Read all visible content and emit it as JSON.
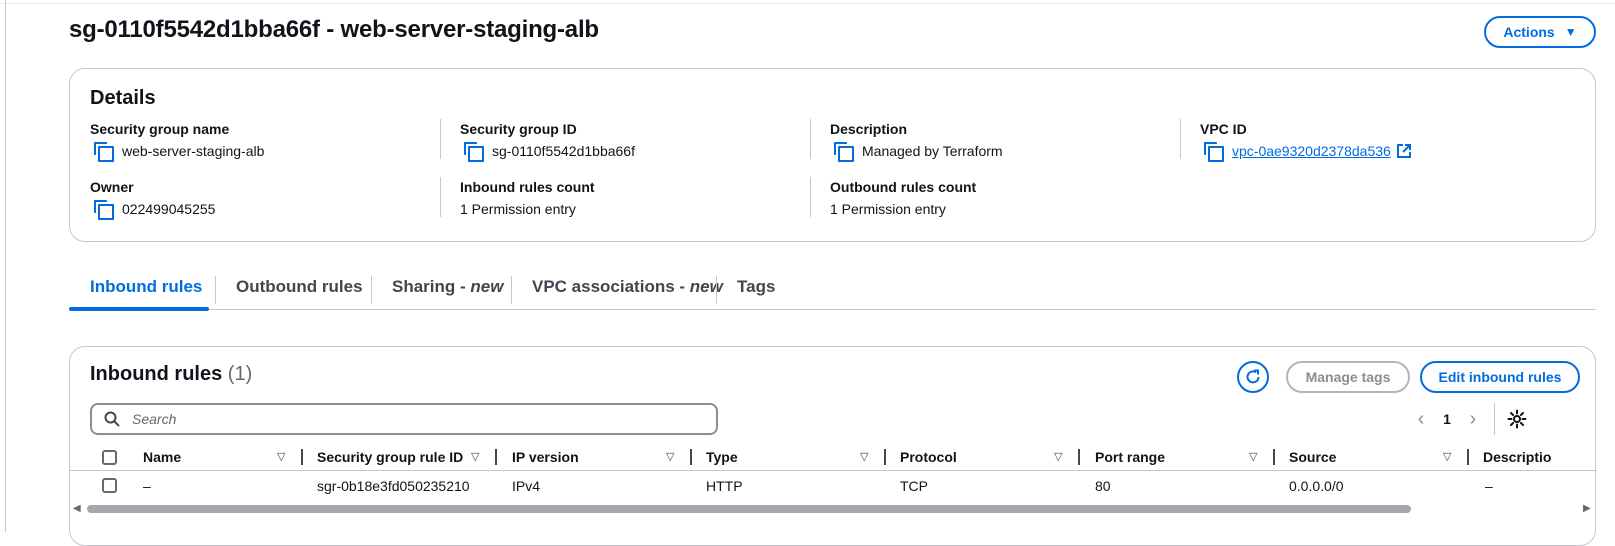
{
  "page": {
    "title": "sg-0110f5542d1bba66f - web-server-staging-alb",
    "actions_label": "Actions",
    "actions_caret": "▼"
  },
  "details": {
    "title": "Details",
    "security_group_name": {
      "label": "Security group name",
      "value": "web-server-staging-alb"
    },
    "security_group_id": {
      "label": "Security group ID",
      "value": "sg-0110f5542d1bba66f"
    },
    "description": {
      "label": "Description",
      "value": "Managed by Terraform"
    },
    "vpc_id": {
      "label": "VPC ID",
      "value": "vpc-0ae9320d2378da536"
    },
    "owner": {
      "label": "Owner",
      "value": "022499045255"
    },
    "inbound_count": {
      "label": "Inbound rules count",
      "value": "1 Permission entry"
    },
    "outbound_count": {
      "label": "Outbound rules count",
      "value": "1 Permission entry"
    }
  },
  "tabs": [
    {
      "label": "Inbound rules",
      "suffix": "",
      "active": true
    },
    {
      "label": "Outbound rules",
      "suffix": "",
      "active": false
    },
    {
      "label": "Sharing - ",
      "suffix": "new",
      "active": false
    },
    {
      "label": "VPC associations - ",
      "suffix": "new",
      "active": false
    },
    {
      "label": "Tags",
      "suffix": "",
      "active": false
    }
  ],
  "inbound": {
    "title": "Inbound rules",
    "count": "(1)",
    "manage_tags_label": "Manage tags",
    "edit_label": "Edit inbound rules",
    "search_placeholder": "Search",
    "page_number": "1",
    "prev_arrow": "‹",
    "next_arrow": "›",
    "columns": [
      "Name",
      "Security group rule ID",
      "IP version",
      "Type",
      "Protocol",
      "Port range",
      "Source",
      "Descriptio"
    ],
    "rows": [
      {
        "name": "–",
        "rule_id": "sgr-0b18e3fd050235210",
        "ip_version": "IPv4",
        "type": "HTTP",
        "protocol": "TCP",
        "port_range": "80",
        "source": "0.0.0.0/0",
        "description": "–"
      }
    ]
  },
  "colors": {
    "accent": "#006ce0",
    "border": "#c6c6cd",
    "text": "#0f141a",
    "disabled": "#8c8c94"
  },
  "icons": [
    "copy-icon",
    "external-link-icon",
    "refresh-icon",
    "search-icon",
    "settings-icon",
    "sort-icon",
    "chevron-left-icon",
    "chevron-right-icon"
  ]
}
